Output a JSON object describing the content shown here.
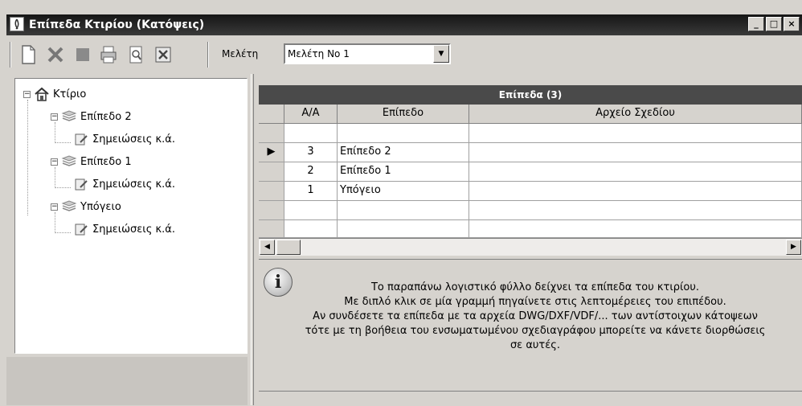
{
  "window": {
    "title": "Επίπεδα Κτιρίου (Κατόψεις)",
    "buttons": [
      "_",
      "□",
      "×"
    ]
  },
  "toolbar": {
    "icons": [
      "new-icon",
      "delete-icon",
      "stop-icon",
      "print-icon",
      "preview-icon",
      "close-doc-icon"
    ],
    "study_label": "Μελέτη",
    "study_value": "Μελέτη Νο 1"
  },
  "tree": {
    "nodes": [
      {
        "label": "Κτίριο",
        "icon": "house-icon",
        "level": 0
      },
      {
        "label": "Επίπεδο 2",
        "icon": "layers-icon",
        "level": 1
      },
      {
        "label": "Σημειώσεις κ.ά.",
        "icon": "note-icon",
        "level": 2
      },
      {
        "label": "Επίπεδο 1",
        "icon": "layers-icon",
        "level": 1
      },
      {
        "label": "Σημειώσεις κ.ά.",
        "icon": "note-icon",
        "level": 2
      },
      {
        "label": "Υπόγειο",
        "icon": "layers-icon",
        "level": 1
      },
      {
        "label": "Σημειώσεις κ.ά.",
        "icon": "note-icon",
        "level": 2
      }
    ]
  },
  "grid": {
    "title": "Επίπεδα  (3)",
    "columns": [
      "Α/Α",
      "Επίπεδο",
      "Αρχείο Σχεδίου"
    ],
    "rows": [
      {
        "aa": "3",
        "level": "Επίπεδο 2",
        "file": "",
        "current": true
      },
      {
        "aa": "2",
        "level": "Επίπεδο 1",
        "file": ""
      },
      {
        "aa": "1",
        "level": "Υπόγειο",
        "file": ""
      }
    ]
  },
  "info": {
    "lines": [
      "Το παραπάνω λογιστικό φύλλο δείχνει τα επίπεδα του κτιρίου.",
      "Με διπλό κλικ σε μία γραμμή πηγαίνετε στις λεπτομέρειες του επιπέδου.",
      "Αν συνδέσετε τα επίπεδα με τα αρχεία DWG/DXF/VDF/... των αντίστοιχων κάτοψεων",
      "τότε με τη βοήθεια του ενσωματωμένου σχεδιαγράφου μπορείτε να κάνετε διορθώσεις",
      "σε αυτές."
    ]
  }
}
